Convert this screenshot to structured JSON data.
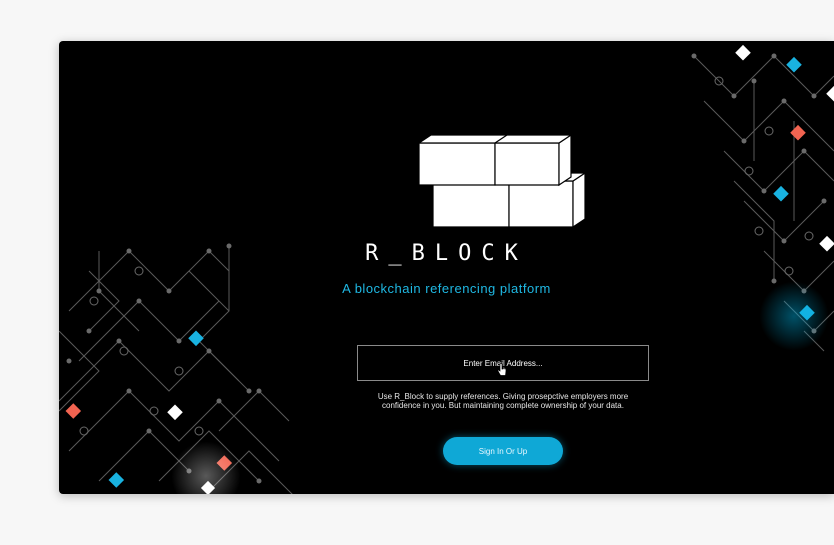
{
  "app": {
    "brand_name": "R_BLOCK",
    "tagline": "A blockchain referencing platform"
  },
  "form": {
    "email_placeholder": "Enter Email Address...",
    "email_value": "",
    "description": "Use R_Block to supply references. Giving prosepctive employers more confidence in you. But maintaining complete ownership of your data.",
    "submit_label": "Sign In Or Up"
  },
  "icons": {
    "logo": "stacked-blocks-icon",
    "cursor": "hand-pointer-icon",
    "decoration": "circuit-pattern"
  },
  "colors": {
    "background": "#000000",
    "accent": "#0fa8d6",
    "tagline": "#1fb8e3",
    "decor_red": "#f26451",
    "decor_blue": "#19b2e0",
    "decor_white": "#ffffff"
  }
}
